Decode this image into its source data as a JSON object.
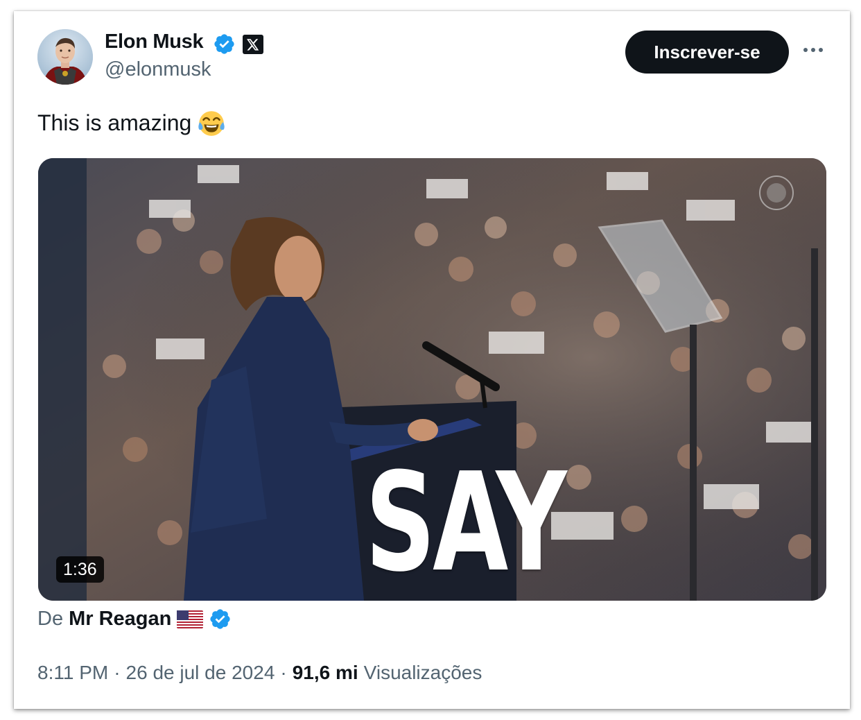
{
  "author": {
    "name": "Elon Musk",
    "handle": "@elonmusk",
    "verified": true,
    "badge_icon": "x-logo-icon"
  },
  "header": {
    "subscribe_label": "Inscrever-se",
    "more_icon": "more-horizontal-icon"
  },
  "tweet": {
    "text": "This is amazing",
    "emoji": "tears-of-joy-emoji"
  },
  "media": {
    "duration": "1:36",
    "overlay_text": "SAY"
  },
  "source": {
    "prefix": "De",
    "name": "Mr Reagan",
    "flag": "us-flag-icon",
    "verified": true
  },
  "meta": {
    "time": "8:11 PM",
    "separator": "·",
    "date": "26 de jul de 2024",
    "views_count": "91,6 mi",
    "views_label": "Visualizações"
  },
  "colors": {
    "verified_blue": "#1d9bf0",
    "text_primary": "#0f1419",
    "text_secondary": "#536471",
    "button_bg": "#0f1419"
  }
}
